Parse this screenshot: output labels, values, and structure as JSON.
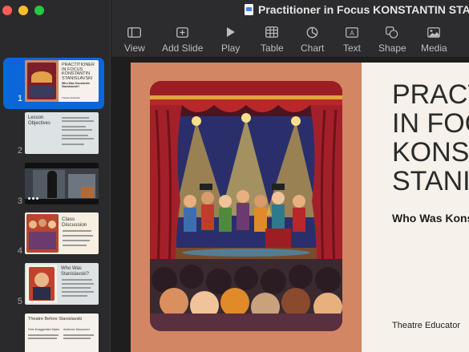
{
  "window": {
    "title": "Practitioner in Focus KONSTANTIN STANISLAVSKI"
  },
  "toolbar": {
    "items": [
      {
        "label": "View",
        "icon": "sidebar-view-icon"
      },
      {
        "label": "Add Slide",
        "icon": "add-slide-icon"
      },
      {
        "label": "Play",
        "icon": "play-icon"
      },
      {
        "label": "Table",
        "icon": "table-icon"
      },
      {
        "label": "Chart",
        "icon": "chart-icon"
      },
      {
        "label": "Text",
        "icon": "text-box-icon"
      },
      {
        "label": "Shape",
        "icon": "shape-icon"
      },
      {
        "label": "Media",
        "icon": "media-icon"
      }
    ]
  },
  "sidebar": {
    "slides": [
      {
        "number": "1",
        "title": "PRACTITIONER IN FOCUS KONSTANTIN STANISLAVSKI",
        "subtitle": "Who Was Konstantin Stanislavski?",
        "footer": "Theatre Educator",
        "selected": true
      },
      {
        "number": "2",
        "title": "Lesson Objectives"
      },
      {
        "number": "3",
        "title": ""
      },
      {
        "number": "4",
        "title": "Class Discussion"
      },
      {
        "number": "5",
        "title": "Who Was Stanislavski?"
      },
      {
        "number": "6",
        "title": "Theatre Before Stanislavski",
        "col1": "Over-Exaggerated Styles",
        "col2": "Audience Disconnect"
      }
    ]
  },
  "slide": {
    "title": "PRACTITIONER\nIN FOCUS\nKONSTANTIN\nSTANISLAVSKI",
    "subtitle": "Who Was Konstantin Stanislavski?",
    "footer": "Theatre Educator",
    "colors": {
      "panel": "#d28664",
      "background": "#f6f1ea"
    }
  }
}
